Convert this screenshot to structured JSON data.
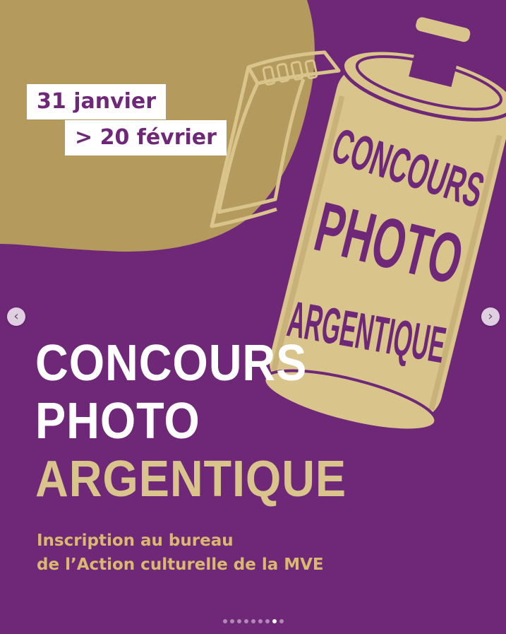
{
  "post": {
    "colors": {
      "background": "#6f2878",
      "blob": "#b59a5e",
      "gold": "#d9c58c",
      "text_gold": "#d9b870"
    },
    "dates": [
      "31 janvier",
      "> 20 février"
    ],
    "title_lines": [
      "CONCOURS",
      "PHOTO",
      "ARGENTIQUE"
    ],
    "subtitle_lines": [
      "Inscription au bureau",
      "de l’Action culturelle de la MVE"
    ],
    "film_lettering": [
      "CONCOURS",
      "PHOTO",
      "ARGENTIQUE"
    ],
    "carousel": {
      "total": 9,
      "active_index": 7
    },
    "nav": {
      "prev_icon": "chevron-left-icon",
      "next_icon": "chevron-right-icon",
      "prev_glyph": "‹",
      "next_glyph": "›"
    }
  }
}
